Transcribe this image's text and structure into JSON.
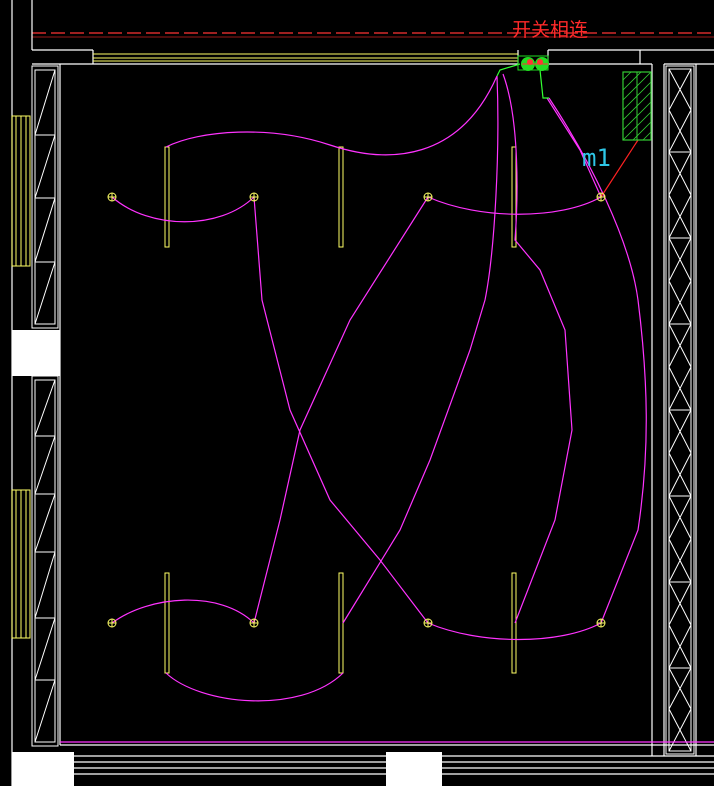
{
  "annotations": {
    "switch_note": "开关相连",
    "panel_label": "m1"
  },
  "colors": {
    "background": "#000000",
    "wiring": "#ff33ff",
    "walls": "#ffffff",
    "fixtures": "#ffff66",
    "panel": "#33cc33",
    "switch": "#22dd22",
    "annotation_red": "#ff2a2a",
    "annotation_cyan": "#2ec6e6"
  },
  "legend": {
    "light_fixture_symbol": "light-fixture-icon",
    "switch_symbol": "switch-icon",
    "panel_symbol": "distribution-panel-icon"
  }
}
